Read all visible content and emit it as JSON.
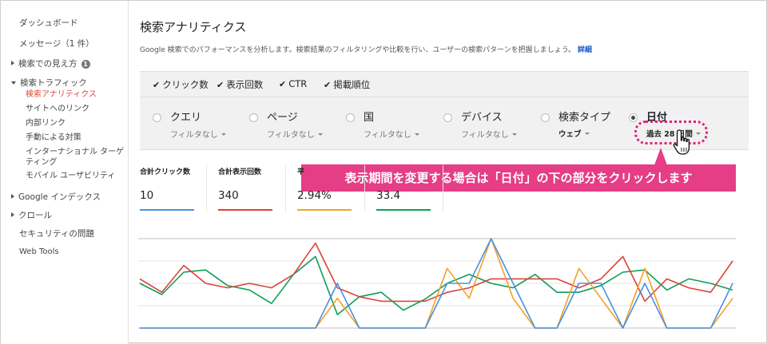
{
  "sidebar": {
    "dashboard": "ダッシュボード",
    "messages": "メッセージ（1 件）",
    "search_appearance": "検索での見え方",
    "search_appearance_badge": "1",
    "search_traffic": "検索トラフィック",
    "search_traffic_items": [
      "検索アナリティクス",
      "サイトへのリンク",
      "内部リンク",
      "手動による対策",
      "インターナショナル ターゲ",
      "ティング",
      "モバイル ユーザビリティ"
    ],
    "google_index": "Google インデックス",
    "crawl": "クロール",
    "security": "セキュリティの問題",
    "web_tools": "Web Tools"
  },
  "header": {
    "title": "検索アナリティクス",
    "description": "Google 検索でのパフォーマンスを分析します。検索結果のフィルタリングや比較を行い、ユーザーの検索パターンを把握しましょう。",
    "details_link": "詳細"
  },
  "metrics": [
    {
      "label": "クリック数",
      "checked": true
    },
    {
      "label": "表示回数",
      "checked": true
    },
    {
      "label": "CTR",
      "checked": true
    },
    {
      "label": "掲載順位",
      "checked": true
    }
  ],
  "filters": [
    {
      "label": "クエリ",
      "sub": "フィルタなし",
      "selected": false
    },
    {
      "label": "ページ",
      "sub": "フィルタなし",
      "selected": false
    },
    {
      "label": "国",
      "sub": "フィルタなし",
      "selected": false
    },
    {
      "label": "デバイス",
      "sub": "フィルタなし",
      "selected": false
    },
    {
      "label": "検索タイプ",
      "sub": "ウェブ",
      "selected": false
    },
    {
      "label": "日付",
      "sub": "過去 28 日間",
      "selected": true
    }
  ],
  "callout": "表示期間を変更する場合は「日付」の下の部分をクリックします",
  "totals": [
    {
      "label": "合計クリック数",
      "value": "10",
      "color": "#4a90e2"
    },
    {
      "label": "合計表示回数",
      "value": "340",
      "color": "#db4437"
    },
    {
      "label": "平",
      "value": "2.94%",
      "color": "#f4a125"
    },
    {
      "label": "",
      "value": "33.4",
      "color": "#0f9d58"
    }
  ],
  "colors": {
    "accent_pink": "#e53d86",
    "active_nav": "#dd4b39",
    "link": "#1155cc",
    "clicks": "#4a90e2",
    "impressions": "#db4437",
    "ctr": "#f4a125",
    "position": "#0f9d58"
  },
  "chart_data": {
    "type": "line",
    "x": [
      1,
      2,
      3,
      4,
      5,
      6,
      7,
      8,
      9,
      10,
      11,
      12,
      13,
      14,
      15,
      16,
      17,
      18,
      19,
      20,
      21,
      22,
      23,
      24,
      25,
      26,
      27,
      28
    ],
    "series": [
      {
        "name": "クリック数",
        "values": [
          0,
          0,
          0,
          0,
          0,
          0,
          0,
          0,
          0,
          1,
          0,
          0,
          0,
          0,
          1,
          1,
          2,
          1,
          0,
          0,
          1,
          1,
          0,
          1,
          0,
          0,
          0,
          1
        ]
      },
      {
        "name": "表示回数",
        "values": [
          11,
          8,
          14,
          10,
          9,
          10,
          9,
          12,
          19,
          9,
          7,
          6,
          6,
          6,
          8,
          9,
          11,
          11,
          11,
          11,
          9,
          11,
          16,
          6,
          11,
          9,
          8,
          15
        ]
      },
      {
        "name": "CTR",
        "values": [
          0,
          0,
          0,
          0,
          0,
          0,
          0,
          0,
          0,
          1,
          0,
          0,
          0,
          0,
          2,
          1,
          3,
          1,
          0,
          0,
          2,
          1,
          0,
          2,
          0,
          0,
          0,
          1
        ]
      },
      {
        "name": "掲載順位",
        "values": [
          40,
          35,
          45,
          46,
          39,
          37,
          31,
          44,
          52,
          26,
          34,
          36,
          28,
          33,
          40,
          44,
          40,
          38,
          44,
          36,
          36,
          39,
          45,
          46,
          37,
          42,
          40,
          37
        ]
      }
    ]
  }
}
